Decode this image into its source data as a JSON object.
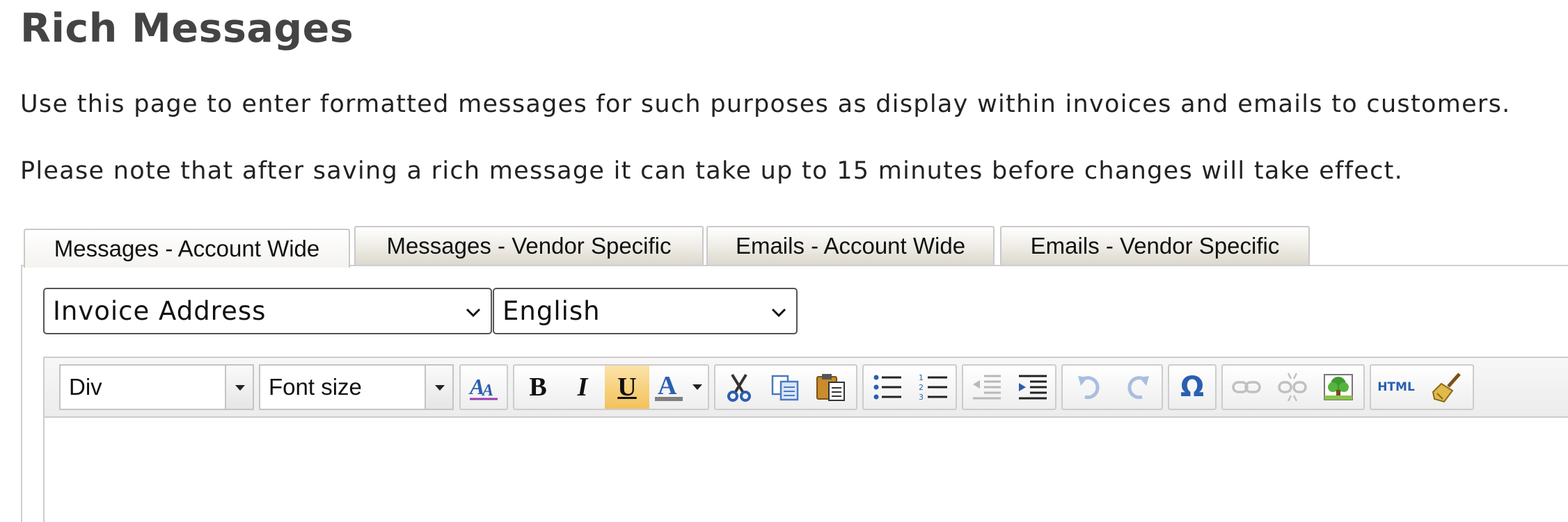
{
  "page": {
    "title": "Rich Messages",
    "intro_1": "Use this page to enter formatted messages for such purposes as display within invoices and emails to customers.",
    "intro_2": "Please note that after saving a rich message it can take up to 15 minutes before changes will take effect."
  },
  "tabs": [
    {
      "label": "Messages - Account Wide",
      "active": true
    },
    {
      "label": "Messages - Vendor Specific",
      "active": false
    },
    {
      "label": "Emails - Account Wide",
      "active": false
    },
    {
      "label": "Emails - Vendor Specific",
      "active": false
    }
  ],
  "selects": {
    "message_type": "Invoice Address",
    "language": "English"
  },
  "toolbar": {
    "format_value": "Div",
    "font_size_placeholder": "Font size",
    "bold_glyph": "B",
    "italic_glyph": "I",
    "underline_glyph": "U",
    "underline_active": true,
    "omega_glyph": "Ω",
    "html_label": "HTML",
    "icons": [
      "style-icon",
      "bold-icon",
      "italic-icon",
      "underline-icon",
      "text-color-icon",
      "cut-icon",
      "copy-icon",
      "paste-icon",
      "bullet-list-icon",
      "numbered-list-icon",
      "outdent-icon",
      "indent-icon",
      "undo-icon",
      "redo-icon",
      "special-char-icon",
      "link-icon",
      "unlink-icon",
      "image-icon",
      "html-source-icon",
      "cleanup-icon"
    ]
  },
  "colors": {
    "accent_active_button": "#f3c15a",
    "icon_blue": "#2a5fb0",
    "text_color_bar": "#808080"
  }
}
